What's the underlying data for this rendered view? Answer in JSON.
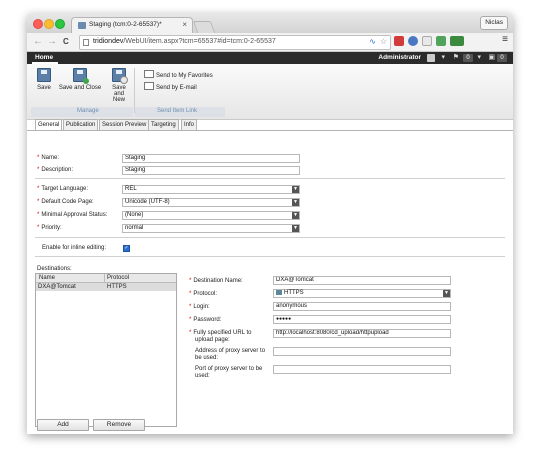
{
  "browser": {
    "tab_title": "Staging (tcm:0-2-65537)*",
    "tab_close": "×",
    "user_button": "Niclas",
    "back": "←",
    "forward": "→",
    "reload": "C",
    "url_host": "tridiondev",
    "url_path": "/WebUI/item.aspx?tcm=65537#id=tcm:0-2-65537",
    "menu": "≡"
  },
  "appbar": {
    "home": "Home",
    "user": "Administrator",
    "badge1": "0",
    "badge2": "0"
  },
  "ribbon": {
    "save": "Save",
    "save_close": "Save and Close",
    "save_new_1": "Save and",
    "save_new_2": "New",
    "send_fav": "Send to My Favorites",
    "send_email": "Send by E-mail",
    "group_manage": "Manage",
    "group_send": "Send Item Link"
  },
  "tabs": [
    "General",
    "Publication",
    "Session Preview",
    "Targeting",
    "Info"
  ],
  "form": {
    "name_label": "Name:",
    "name_value": "Staging",
    "desc_label": "Description:",
    "desc_value": "Staging",
    "target_lang_label": "Target Language:",
    "target_lang_value": "REL",
    "code_page_label": "Default Code Page:",
    "code_page_value": "Unicode (UTF-8)",
    "approval_label": "Minimal Approval Status:",
    "approval_value": "(None)",
    "priority_label": "Priority:",
    "priority_value": "normal",
    "inline_label": "Enable for inline editing:",
    "inline_checked": "✓"
  },
  "destinations": {
    "label": "Destinations:",
    "col_name": "Name",
    "col_protocol": "Protocol",
    "rows": [
      {
        "name": "DXA@Tomcat",
        "protocol": "HTTPS"
      }
    ],
    "add": "Add",
    "remove": "Remove"
  },
  "dest_detail": {
    "dest_name_label": "Destination Name:",
    "dest_name_value": "DXA@Tomcat",
    "protocol_label": "Protocol:",
    "protocol_value": "HTTPS",
    "login_label": "Login:",
    "login_value": "anonymous",
    "password_label": "Password:",
    "password_value": "●●●●●",
    "url_label_1": "Fully specified URL to",
    "url_label_2": "upload page:",
    "url_value": "http://localhost:8080/cd_upload/httpupload",
    "proxy_addr_label_1": "Address of proxy server to",
    "proxy_addr_label_2": "be used:",
    "proxy_port_label_1": "Port of proxy server to be",
    "proxy_port_label_2": "used:"
  },
  "colors": {
    "required": "#d10000",
    "appbar": "#2b2b2b",
    "group_label": "#6e8fb2",
    "checkbox": "#2a6fcf"
  }
}
